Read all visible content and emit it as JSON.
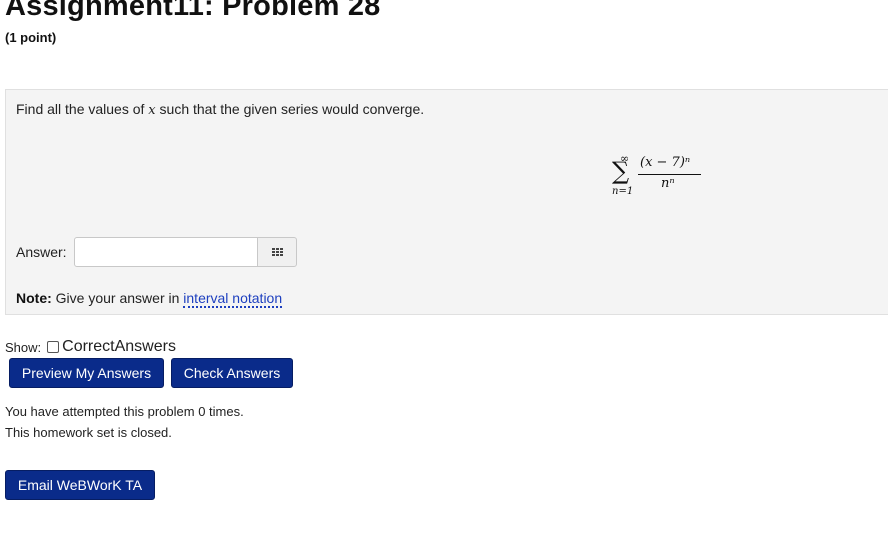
{
  "problem": {
    "title": "Assignment11: Problem 28",
    "points": "(1 point)",
    "prompt_before": "Find all the values of ",
    "prompt_var": "x",
    "prompt_after": " such that the given series would converge.",
    "series": {
      "upper": "∞",
      "sigma": "∑",
      "lower": "n=1",
      "numerator": "(x − 7)ⁿ",
      "denominator": "nⁿ"
    },
    "answer_label": "Answer:",
    "answer_value": "",
    "answer_placeholder": "",
    "palette_icon": "grid-icon",
    "note_label": "Note:",
    "note_text": " Give your answer in ",
    "note_link": "interval notation"
  },
  "controls": {
    "show_label": "Show:",
    "correct_answers_label": "CorrectAnswers",
    "correct_answers_checked": false,
    "preview_label": "Preview My Answers",
    "check_label": "Check Answers",
    "email_label": "Email WeBWorK TA"
  },
  "status": {
    "attempts": "You have attempted this problem 0 times.",
    "closed": "This homework set is closed."
  },
  "colors": {
    "button_bg": "#0a2b8a",
    "link": "#1d3fbf",
    "problem_bg": "#f4f4f4"
  }
}
